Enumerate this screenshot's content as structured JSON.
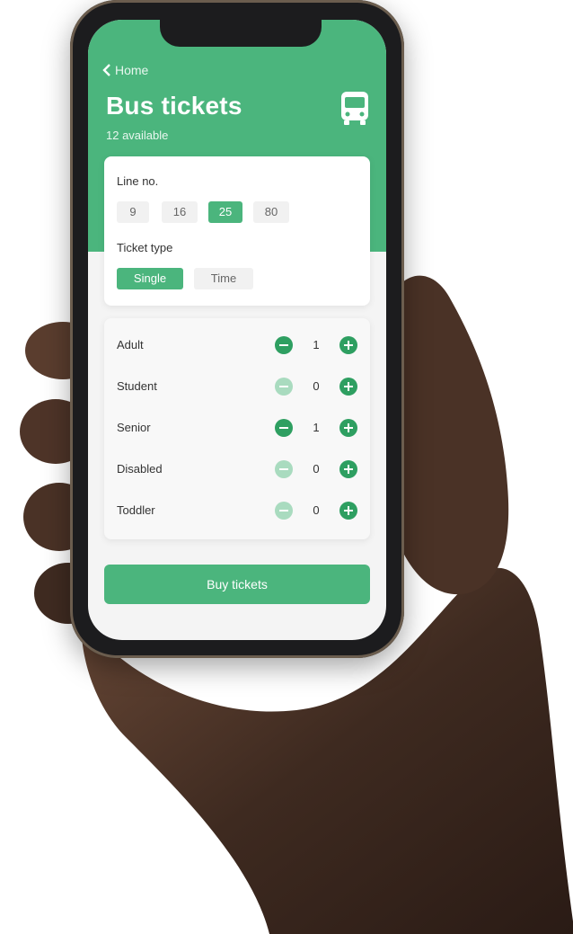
{
  "header": {
    "back_label": "Home",
    "title": "Bus tickets",
    "subtitle": "12 available"
  },
  "line": {
    "label": "Line no.",
    "options": [
      "9",
      "16",
      "25",
      "80"
    ],
    "selected": "25"
  },
  "ticket_type": {
    "label": "Ticket type",
    "options": [
      "Single",
      "Time"
    ],
    "selected": "Single"
  },
  "passengers": [
    {
      "name": "Adult",
      "qty": "1"
    },
    {
      "name": "Student",
      "qty": "0"
    },
    {
      "name": "Senior",
      "qty": "1"
    },
    {
      "name": "Disabled",
      "qty": "0"
    },
    {
      "name": "Toddler",
      "qty": "0"
    }
  ],
  "buy_label": "Buy tickets",
  "colors": {
    "accent": "#4bb57d",
    "accent_dark": "#2e9f61",
    "accent_faded": "#a9dbbf"
  },
  "icons": [
    "chevron-left-icon",
    "bus-icon",
    "minus-icon",
    "plus-icon"
  ]
}
